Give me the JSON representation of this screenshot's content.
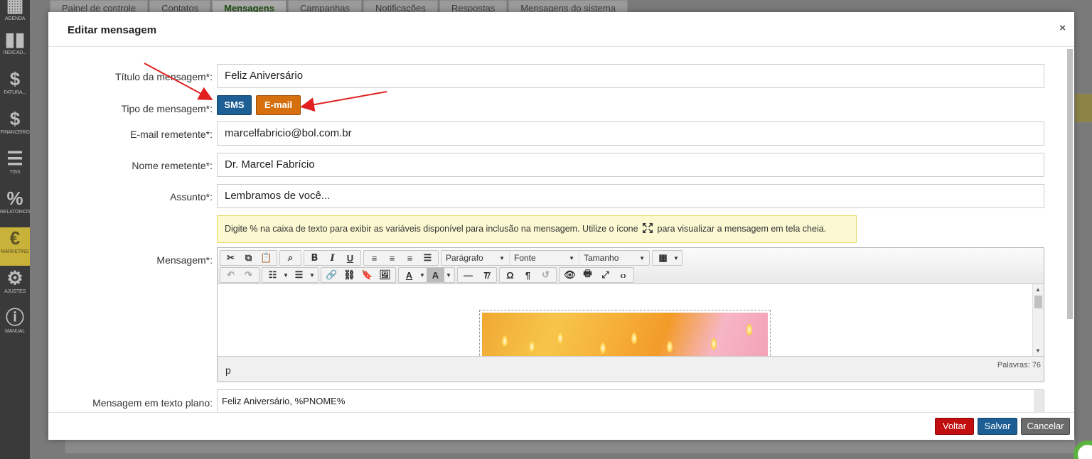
{
  "sidebar": {
    "items": [
      {
        "label": "AGENDA",
        "icon": "calendar-icon"
      },
      {
        "label": "INDICAD...",
        "icon": "bar-chart-icon"
      },
      {
        "label": "FATURA...",
        "icon": "dollar-icon"
      },
      {
        "label": "FINANCEIRO",
        "icon": "dollar-icon"
      },
      {
        "label": "TISS",
        "icon": "document-icon"
      },
      {
        "label": "RELATÓRIOS",
        "icon": "percent-icon"
      },
      {
        "label": "MARKETING",
        "icon": "marketing-icon"
      },
      {
        "label": "AJUSTES",
        "icon": "gear-icon"
      },
      {
        "label": "MANUAL",
        "icon": "info-icon"
      }
    ]
  },
  "background_tabs": [
    "Painel de controle",
    "Contatos",
    "Mensagens",
    "Campanhas",
    "Notificações",
    "Respostas",
    "Mensagens do sistema"
  ],
  "modal": {
    "title": "Editar mensagem",
    "close_glyph": "×",
    "fields": {
      "titulo": {
        "label": "Título da mensagem*:",
        "value": "Feliz Aniversário"
      },
      "tipo": {
        "label": "Tipo de mensagem*:",
        "sms": "SMS",
        "email": "E-mail"
      },
      "email_remetente": {
        "label": "E-mail remetente*:",
        "value": "marcelfabricio@bol.com.br"
      },
      "nome_remetente": {
        "label": "Nome remetente*:",
        "value": "Dr. Marcel Fabrício"
      },
      "assunto": {
        "label": "Assunto*:",
        "value": "Lembramos de você..."
      }
    },
    "info": {
      "before": "Digite % na caixa de texto para exibir as variáveis disponível para inclusão na mensagem. Utilize o ícone",
      "after": "para visualizar a mensagem em tela cheia."
    },
    "editor": {
      "label": "Mensagem*:",
      "paragraph_select": "Parágrafo",
      "font_select": "Fonte",
      "size_select": "Tamanho",
      "status_path": "p",
      "word_count": "Palavras: 76"
    },
    "plain_text": {
      "label": "Mensagem em texto plano:",
      "value": "Feliz Aniversário, %PNOME%"
    },
    "footer": {
      "voltar": "Voltar",
      "salvar": "Salvar",
      "cancelar": "Cancelar"
    }
  },
  "colors": {
    "sms_button": "#1d5e94",
    "email_button": "#d66f0d",
    "voltar_button": "#c10e0e",
    "salvar_button": "#1d5e94",
    "cancelar_button": "#6b6b6b",
    "annotation_arrow": "#e02020",
    "info_background": "#fcf8d2"
  }
}
